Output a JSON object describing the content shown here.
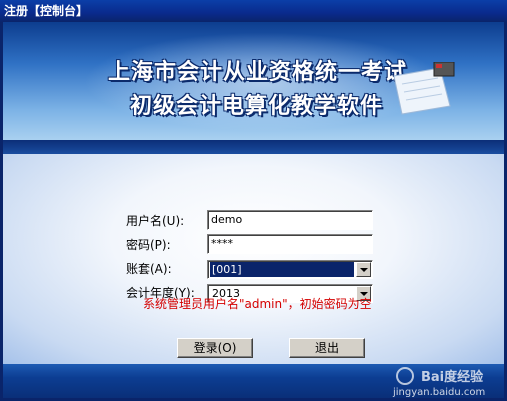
{
  "window": {
    "title": "注册【控制台】",
    "close_label": "×"
  },
  "banner": {
    "title_line1": "上海市会计从业资格统一考试",
    "title_line2": "初级会计电算化教学软件"
  },
  "form": {
    "username_label": "用户名(U):",
    "username_value": "demo",
    "password_label": "密码(P):",
    "password_value": "****",
    "account_label": "账套(A):",
    "account_value": "[001]",
    "year_label": "会计年度(Y):",
    "year_value": "2013"
  },
  "notice": "系统管理员用户名\"admin\"，初始密码为空",
  "buttons": {
    "login": "登录(O)",
    "exit": "退出"
  },
  "watermark": {
    "brand": "Bai度经验",
    "url": "jingyan.baidu.com"
  },
  "colors": {
    "title_bar": "#0a246a",
    "notice": "#d40000",
    "banner_light": "#a9d0f0"
  }
}
